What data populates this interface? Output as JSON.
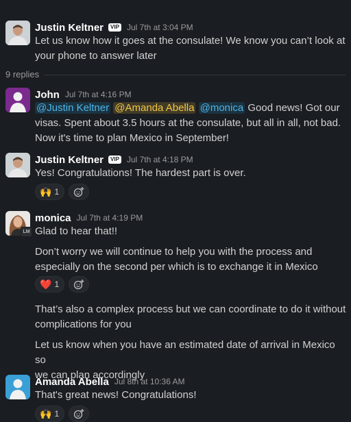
{
  "thread": {
    "parent": {
      "author": "Justin Keltner",
      "badge": "VIP",
      "time": "Jul 7th at 3:04 PM",
      "line1": "Let us know how it goes at the consulate! We know you can’t look at",
      "line2": "your phone to answer later"
    },
    "reply_count_label": "9 replies"
  },
  "messages": [
    {
      "author": "John",
      "time": "Jul 7th at 4:16 PM",
      "mentions": [
        "@Justin Keltner",
        "@Amanda Abella",
        "@monica"
      ],
      "line1_rest": "Good news! Got our",
      "line2": "visas. Spent about 3.5 hours at the consulate, but all in all, not bad.",
      "line3": "Now it's time to plan Mexico in September!"
    },
    {
      "author": "Justin Keltner",
      "badge": "VIP",
      "time": "Jul 7th at 4:18 PM",
      "text": "Yes! Congratulations! The hardest part is over.",
      "reaction": {
        "emoji": "🙌",
        "count": "1"
      }
    },
    {
      "author": "monica",
      "initials": "LM",
      "time": "Jul 7th at 4:19 PM",
      "text": "Glad to hear that!!",
      "p2_line1": "Don’t worry we will continue to help you with the process and",
      "p2_line2": "especially on the second per which is to exchange it in Mexico",
      "reaction": {
        "emoji": "❤️",
        "count": "1"
      },
      "p3_line1": "That’s also a complex process but we can coordinate to do it without",
      "p3_line2": "complications for you",
      "p4_line1": "Let us know when you have an estimated date of arrival in Mexico so",
      "p4_line2": "we can plan accordingly"
    },
    {
      "author": "Amanda Abella",
      "time": "Jul 8th at 10:36 AM",
      "text": "That's great news! Congratulations!",
      "reaction": {
        "emoji": "🙌",
        "count": "1"
      }
    }
  ],
  "colors": {
    "background": "#1a1d21",
    "mention": "#4fb4e6",
    "mention_self": "#f2c744",
    "text": "#d1d2d3"
  },
  "icons": {
    "add_reaction": "add-reaction-icon"
  }
}
